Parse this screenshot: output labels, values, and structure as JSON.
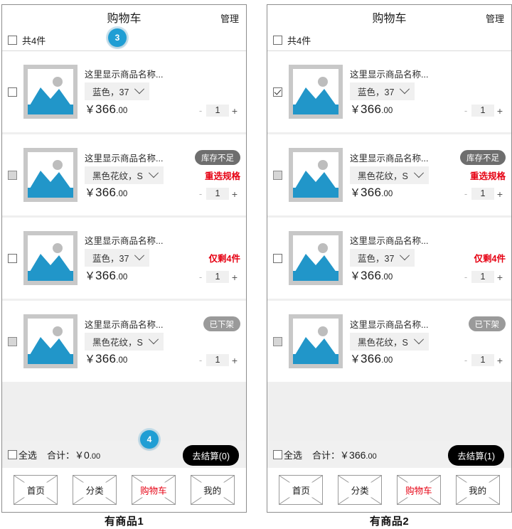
{
  "screens": [
    {
      "caption": "有商品1",
      "header": {
        "title": "购物车",
        "manage": "管理"
      },
      "count_row": {
        "label": "共4件",
        "checked": false
      },
      "items": [
        {
          "name": "这里显示商品名称...",
          "spec": "蓝色，37",
          "price_yen": "￥",
          "price_major": "366",
          "price_minor": ".00",
          "qty": "1",
          "minus": "-",
          "plus": "+",
          "badge": "",
          "badge_style": "",
          "warn": "",
          "checkbox_state": "unchecked"
        },
        {
          "name": "这里显示商品名称...",
          "spec": "黑色花纹，S",
          "price_yen": "￥",
          "price_major": "366",
          "price_minor": ".00",
          "qty": "1",
          "minus": "-",
          "plus": "+",
          "badge": "库存不足",
          "badge_style": "dark",
          "warn": "重选规格",
          "checkbox_state": "disabled"
        },
        {
          "name": "这里显示商品名称...",
          "spec": "蓝色，37",
          "price_yen": "￥",
          "price_major": "366",
          "price_minor": ".00",
          "qty": "1",
          "minus": "-",
          "plus": "+",
          "badge": "",
          "badge_style": "",
          "warn": "仅剩4件",
          "checkbox_state": "unchecked"
        },
        {
          "name": "这里显示商品名称...",
          "spec": "黑色花纹，S",
          "price_yen": "￥",
          "price_major": "366",
          "price_minor": ".00",
          "qty": "1",
          "minus": "-",
          "plus": "+",
          "badge": "已下架",
          "badge_style": "light",
          "warn": "",
          "checkbox_state": "disabled"
        }
      ],
      "footer": {
        "select_all": "全选",
        "total_label": "合计：",
        "total_yen": "￥",
        "total_major": "0",
        "total_minor": ".00",
        "checkout": "去结算(0)",
        "select_all_checked": false
      },
      "tabs": [
        {
          "label": "首页",
          "active": false
        },
        {
          "label": "分类",
          "active": false
        },
        {
          "label": "购物车",
          "active": true
        },
        {
          "label": "我的",
          "active": false
        }
      ]
    },
    {
      "caption": "有商品2",
      "header": {
        "title": "购物车",
        "manage": "管理"
      },
      "count_row": {
        "label": "共4件",
        "checked": false
      },
      "items": [
        {
          "name": "这里显示商品名称...",
          "spec": "蓝色，37",
          "price_yen": "￥",
          "price_major": "366",
          "price_minor": ".00",
          "qty": "1",
          "minus": "-",
          "plus": "+",
          "badge": "",
          "badge_style": "",
          "warn": "",
          "checkbox_state": "checked"
        },
        {
          "name": "这里显示商品名称...",
          "spec": "黑色花纹，S",
          "price_yen": "￥",
          "price_major": "366",
          "price_minor": ".00",
          "qty": "1",
          "minus": "-",
          "plus": "+",
          "badge": "库存不足",
          "badge_style": "dark",
          "warn": "重选规格",
          "checkbox_state": "disabled"
        },
        {
          "name": "这里显示商品名称...",
          "spec": "蓝色，37",
          "price_yen": "￥",
          "price_major": "366",
          "price_minor": ".00",
          "qty": "1",
          "minus": "-",
          "plus": "+",
          "badge": "",
          "badge_style": "",
          "warn": "仅剩4件",
          "checkbox_state": "unchecked"
        },
        {
          "name": "这里显示商品名称...",
          "spec": "黑色花纹，S",
          "price_yen": "￥",
          "price_major": "366",
          "price_minor": ".00",
          "qty": "1",
          "minus": "-",
          "plus": "+",
          "badge": "已下架",
          "badge_style": "light",
          "warn": "",
          "checkbox_state": "disabled"
        }
      ],
      "footer": {
        "select_all": "全选",
        "total_label": "合计：",
        "total_yen": "￥",
        "total_major": "366",
        "total_minor": ".00",
        "checkout": "去结算(1)",
        "select_all_checked": false
      },
      "tabs": [
        {
          "label": "首页",
          "active": false
        },
        {
          "label": "分类",
          "active": false
        },
        {
          "label": "购物车",
          "active": true
        },
        {
          "label": "我的",
          "active": false
        }
      ]
    }
  ],
  "annotations": [
    {
      "number": "3",
      "color": "#1f9ed4"
    },
    {
      "number": "4",
      "color": "#1f9ed4"
    }
  ],
  "icons": {
    "thumbnail": "image-placeholder-icon",
    "chevron": "chevron-down-icon",
    "tab": "image-placeholder-icon"
  }
}
